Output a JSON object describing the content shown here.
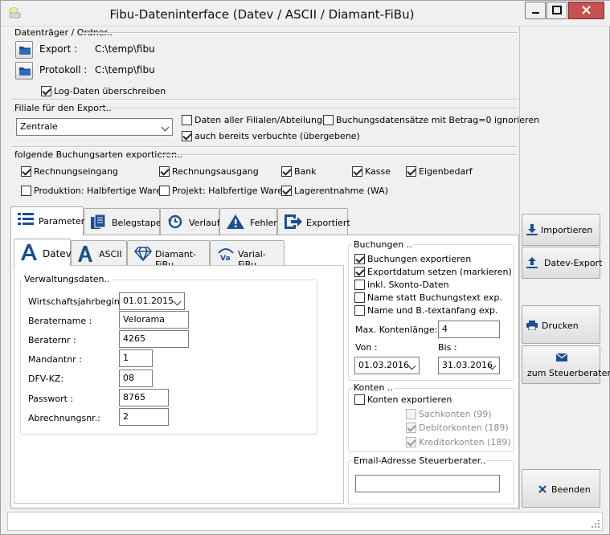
{
  "window": {
    "title": "Fibu-Dateninterface (Datev / ASCII / Diamant-FiBu)"
  },
  "datentraeger": {
    "section_label": "Datenträger / Ordner..",
    "export_label": "Export :",
    "export_path": "C:\\temp\\fibu",
    "protokoll_label": "Protokoll :",
    "protokoll_path": "C:\\temp\\fibu",
    "log_label": "Log-Daten überschreiben",
    "log_checked": true
  },
  "filiale": {
    "section_label": "Filiale für den Export..",
    "selected": "Zentrale",
    "alle_label": "Daten aller Filialen/Abteilungen",
    "alle_checked": false,
    "betrag_label": "Buchungsdatensätze mit Betrag=0 ignorieren",
    "betrag_checked": false,
    "verbucht_label": "auch bereits verbuchte (übergebene)",
    "verbucht_checked": true
  },
  "buchungsarten": {
    "section_label": "folgende Buchungsarten exportieren..",
    "rechnungseingang": "Rechnungseingang",
    "rechnungsausgang": "Rechnungsausgang",
    "bank": "Bank",
    "kasse": "Kasse",
    "eigenbedarf": "Eigenbedarf",
    "produktion": "Produktion: Halbfertige Waren",
    "projekt": "Projekt: Halbfertige Waren",
    "lagerentnahme": "Lagerentnahme (WA)"
  },
  "tabs": {
    "parameter": "Parameter",
    "belegstapel": "Belegstapel",
    "verlauf": "Verlauf",
    "fehler": "Fehler",
    "exportiert": "Exportiert"
  },
  "subtabs": {
    "datev": "Datev",
    "ascii": "ASCII",
    "diamant": "Diamant-FiBu",
    "varial": "Varial-FiBu"
  },
  "verwaltung": {
    "title": "Verwaltungsdaten..",
    "wj_label": "Wirtschaftsjahrbeginn :",
    "wj_value": "01.01.2015",
    "beratername_label": "Beratername :",
    "beratername_value": "Velorama",
    "beraternr_label": "Beraternr :",
    "beraternr_value": "4265",
    "mandantnr_label": "Mandantnr :",
    "mandantnr_value": "1",
    "dfvkz_label": "DFV-KZ:",
    "dfvkz_value": "08",
    "passwort_label": "Passwort :",
    "passwort_value": "8765",
    "abrechnungsnr_label": "Abrechnungsnr.:",
    "abrechnungsnr_value": "2"
  },
  "buchungen": {
    "title": "Buchungen ..",
    "exportieren": "Buchungen exportieren",
    "exportdatum": "Exportdatum setzen (markieren)",
    "skonto": "inkl. Skonto-Daten",
    "name_statt": "Name statt Buchungstext exp.",
    "name_und": "Name und B.-textanfang exp.",
    "max_label": "Max. Kontenlänge:",
    "max_value": "4",
    "von_label": "Von :",
    "von_value": "01.03.2016",
    "bis_label": "Bis :",
    "bis_value": "31.03.2016"
  },
  "konten": {
    "title": "Konten ..",
    "exportieren": "Konten exportieren",
    "sachkonten": "Sachkonten (99)",
    "debitorkonten": "Debitorkonten (189)",
    "kreditorkonten": "Kreditorkonten (189)"
  },
  "email": {
    "title": "Email-Adresse Steuerberater..",
    "value": ""
  },
  "buttons": {
    "importieren": "Importieren",
    "datev_export": "Datev-Export",
    "drucken": "Drucken",
    "steuerberater": "zum Steuerberater",
    "beenden": "Beenden"
  },
  "colors": {
    "accent": "#1a4f8f",
    "close": "#c75050"
  }
}
